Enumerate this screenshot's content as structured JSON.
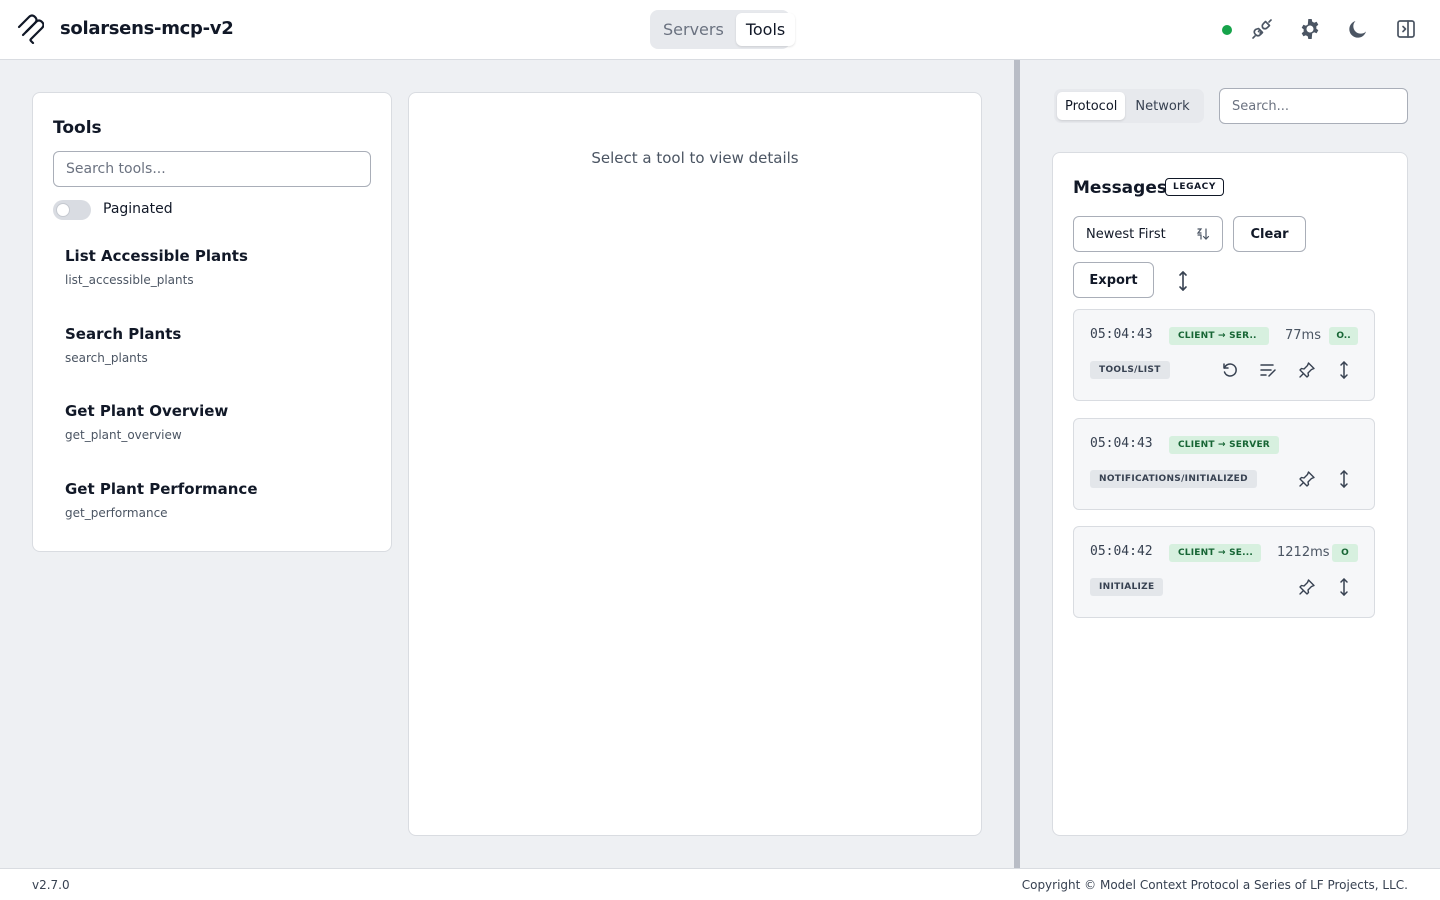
{
  "header": {
    "app_title": "solarsens-mcp-v2",
    "logo_icon": "mcp-logo-icon",
    "nav_tabs": [
      {
        "label": "Servers",
        "active": false
      },
      {
        "label": "Tools",
        "active": true
      }
    ],
    "status_color": "#16a34a",
    "icons": [
      "connection-plug-icon",
      "gear-icon",
      "moon-icon",
      "sidebar-toggle-icon"
    ]
  },
  "tools_panel": {
    "title": "Tools",
    "search_placeholder": "Search tools...",
    "toggle_label": "Paginated",
    "toggle_on": false,
    "items": [
      {
        "name": "List Accessible Plants",
        "id": "list_accessible_plants"
      },
      {
        "name": "Search Plants",
        "id": "search_plants"
      },
      {
        "name": "Get Plant Overview",
        "id": "get_plant_overview"
      },
      {
        "name": "Get Plant Performance",
        "id": "get_performance"
      }
    ]
  },
  "detail_panel": {
    "empty_text": "Select a tool to view details"
  },
  "inspector": {
    "tabs": [
      {
        "label": "Protocol",
        "active": true
      },
      {
        "label": "Network",
        "active": false
      }
    ],
    "search_placeholder": "Search..."
  },
  "messages": {
    "title": "Messages",
    "badge": "LEGACY",
    "sort_value": "Newest First",
    "clear_label": "Clear",
    "export_label": "Export",
    "items": [
      {
        "time": "05:04:43",
        "direction": "CLIENT → SER..",
        "duration": "77ms",
        "status": "O..",
        "method": "TOOLS/LIST"
      },
      {
        "time": "05:04:43",
        "direction": "CLIENT → SERVER",
        "duration": "",
        "status": "",
        "method": "NOTIFICATIONS/INITIALIZED"
      },
      {
        "time": "05:04:42",
        "direction": "CLIENT → SE...",
        "duration": "1212ms",
        "status": "O",
        "method": "INITIALIZE"
      }
    ]
  },
  "footer": {
    "version": "v2.7.0",
    "copyright": "Copyright © Model Context Protocol a Series of LF Projects, LLC."
  }
}
